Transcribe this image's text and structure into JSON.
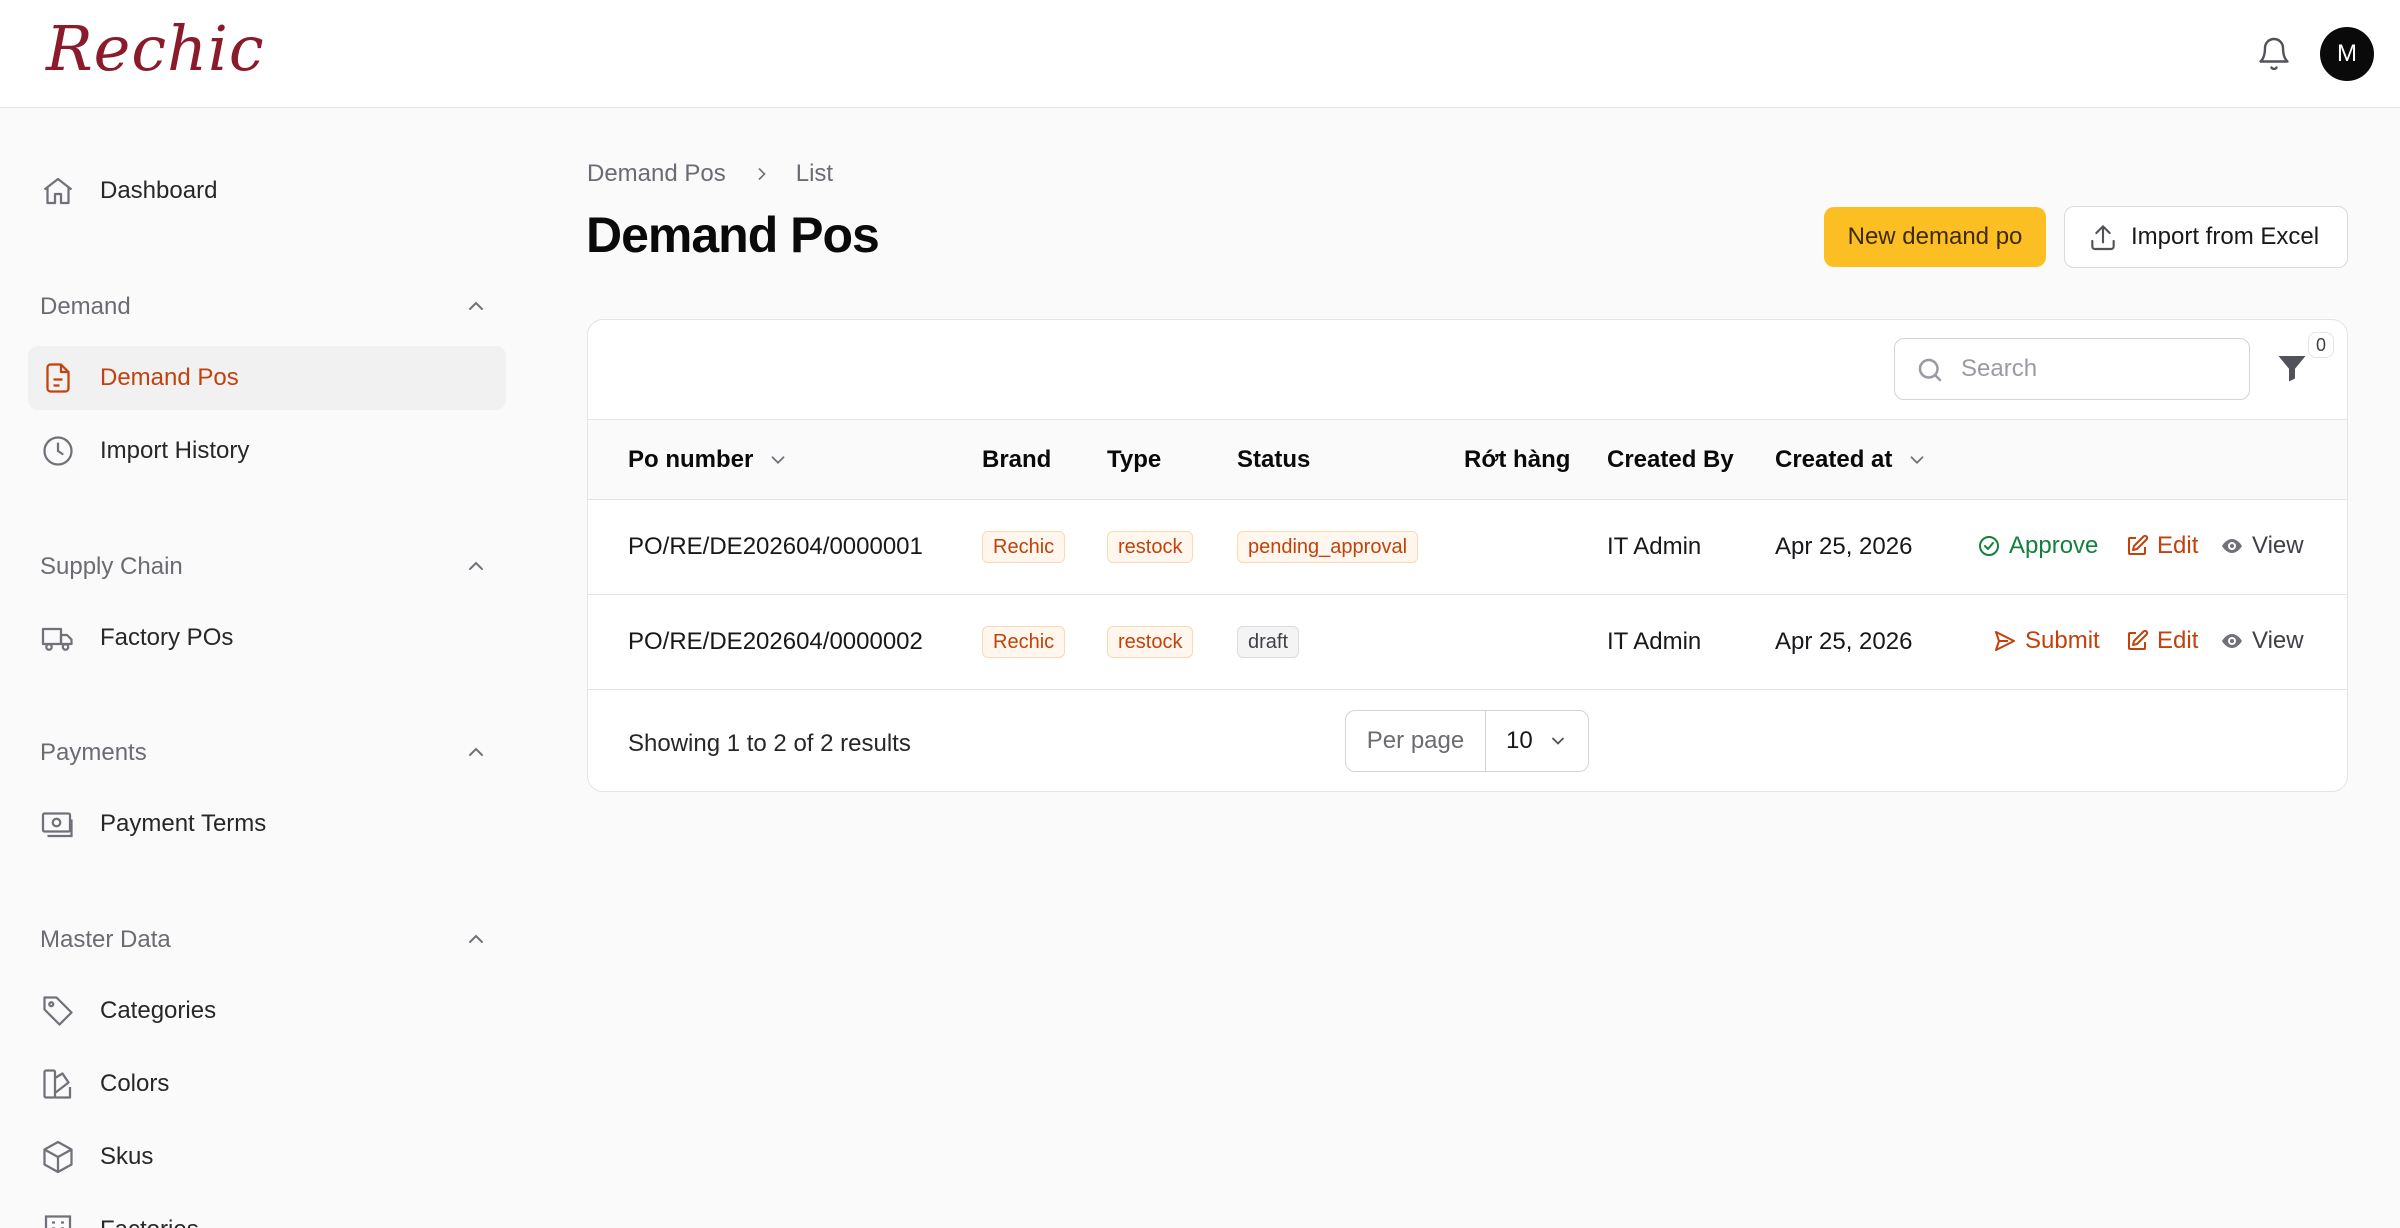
{
  "app": {
    "logo_text": "Rechic",
    "user_initial": "M"
  },
  "sidebar": {
    "dashboard": "Dashboard",
    "groups": [
      {
        "title": "Demand",
        "items": [
          "Demand Pos",
          "Import History"
        ]
      },
      {
        "title": "Supply Chain",
        "items": [
          "Factory POs"
        ]
      },
      {
        "title": "Payments",
        "items": [
          "Payment Terms"
        ]
      },
      {
        "title": "Master Data",
        "items": [
          "Categories",
          "Colors",
          "Skus",
          "Factories"
        ]
      }
    ],
    "active_item": "Demand Pos"
  },
  "breadcrumb": {
    "parent": "Demand Pos",
    "current": "List"
  },
  "page": {
    "title": "Demand Pos",
    "new_button": "New demand po",
    "import_button": "Import from Excel"
  },
  "toolbar": {
    "search_placeholder": "Search",
    "search_value": "",
    "filter_count": "0"
  },
  "table": {
    "columns": {
      "po_number": "Po number",
      "brand": "Brand",
      "type": "Type",
      "status": "Status",
      "rot_hang": "Rớt hàng",
      "created_by": "Created By",
      "created_at": "Created at"
    },
    "rows": [
      {
        "po_number": "PO/RE/DE202604/0000001",
        "brand": "Rechic",
        "type": "restock",
        "status": "pending_approval",
        "rot_hang": "",
        "created_by": "IT Admin",
        "created_at": "Apr 25, 2026",
        "primary_action": "Approve",
        "edit": "Edit",
        "view": "View"
      },
      {
        "po_number": "PO/RE/DE202604/0000002",
        "brand": "Rechic",
        "type": "restock",
        "status": "draft",
        "rot_hang": "",
        "created_by": "IT Admin",
        "created_at": "Apr 25, 2026",
        "primary_action": "Submit",
        "edit": "Edit",
        "view": "View"
      }
    ]
  },
  "pagination": {
    "summary": "Showing 1 to 2 of 2 results",
    "per_page_label": "Per page",
    "per_page_value": "10"
  },
  "colors": {
    "accent": "#fbbf24",
    "active": "#c2410c",
    "success": "#15803d",
    "logo": "#8b1a2b"
  }
}
